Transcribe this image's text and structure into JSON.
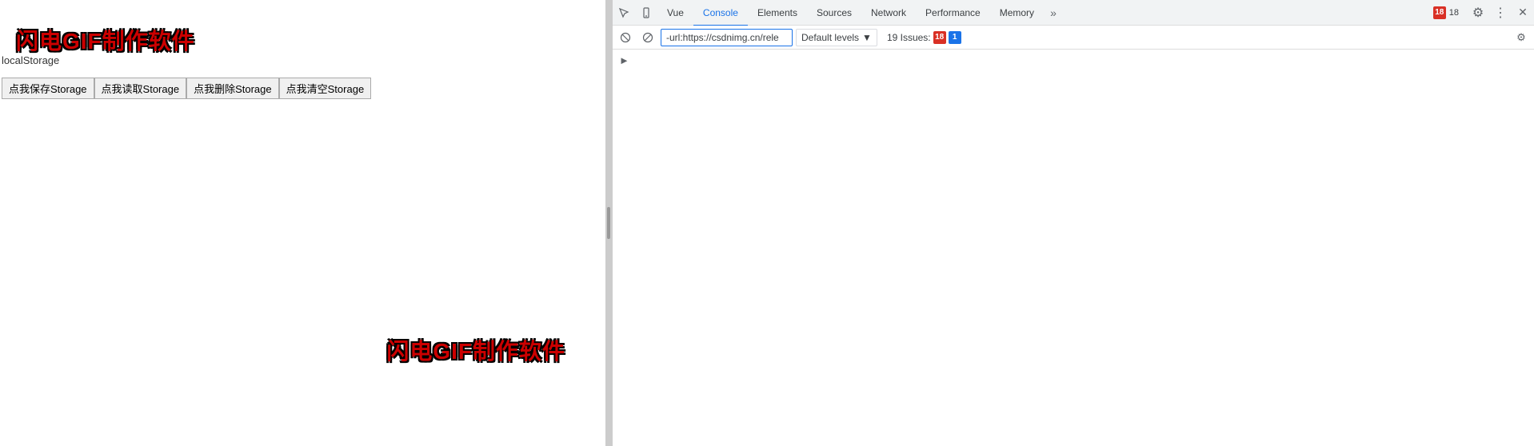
{
  "webpage": {
    "watermark_top": "闪电GIF制作软件",
    "watermark_bottom": "闪电GIF制作软件",
    "page_title": "localStorage",
    "buttons": [
      {
        "label": "点我保存Storage"
      },
      {
        "label": "点我读取Storage"
      },
      {
        "label": "点我删除Storage"
      },
      {
        "label": "点我清空Storage"
      }
    ]
  },
  "devtools": {
    "tabs": [
      {
        "label": "Vue",
        "active": false
      },
      {
        "label": "Console",
        "active": true
      },
      {
        "label": "Elements",
        "active": false
      },
      {
        "label": "Sources",
        "active": false
      },
      {
        "label": "Network",
        "active": false
      },
      {
        "label": "Performance",
        "active": false
      },
      {
        "label": "Memory",
        "active": false
      }
    ],
    "error_badge": "18",
    "toolbar": {
      "filter_placeholder": "-url:https://csdnimg.cn/rele",
      "filter_value": "-url:https://csdnimg.cn/rele",
      "default_levels": "Default levels",
      "issues_label": "19 Issues:",
      "issues_error_count": "18",
      "issues_info_count": "1"
    }
  }
}
